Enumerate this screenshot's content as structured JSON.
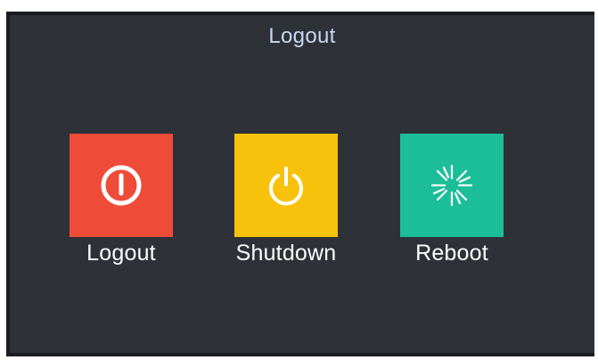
{
  "dialog": {
    "title": "Logout"
  },
  "actions": [
    {
      "id": "logout",
      "label": "Logout",
      "color": "#ef4b39",
      "icon": "power-circle-icon"
    },
    {
      "id": "shutdown",
      "label": "Shutdown",
      "color": "#f8c20c",
      "icon": "power-icon"
    },
    {
      "id": "reboot",
      "label": "Reboot",
      "color": "#1cbe9a",
      "icon": "reboot-spinner-icon"
    }
  ],
  "theme": {
    "dialog_background": "#2e3138",
    "title_color": "#c9d8f0",
    "label_color": "#ffffff"
  }
}
